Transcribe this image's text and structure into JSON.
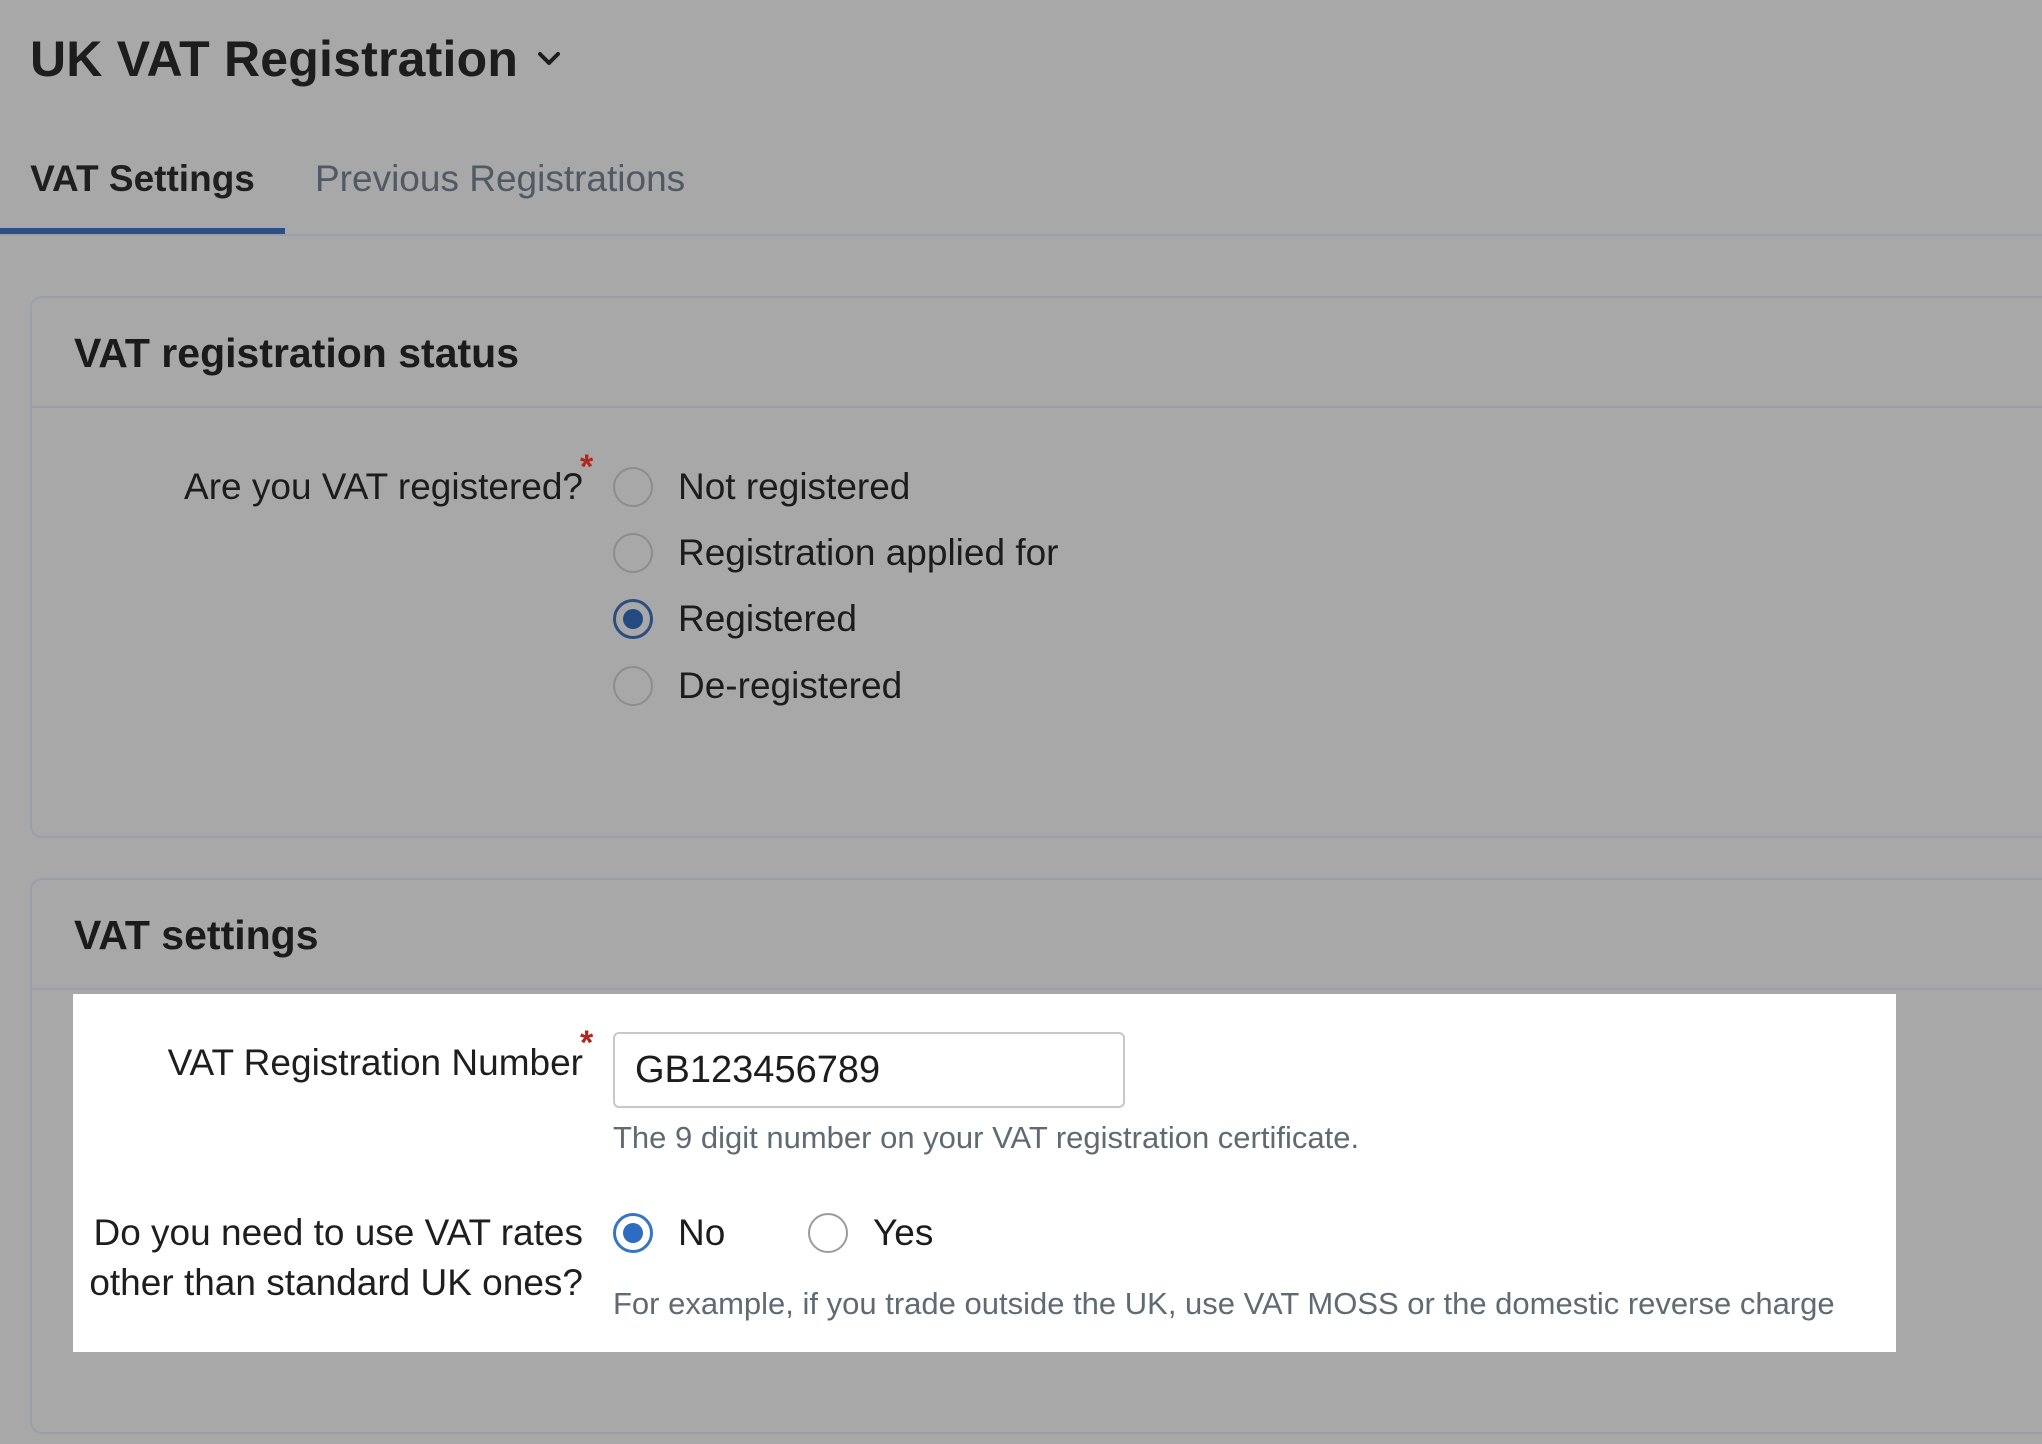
{
  "header": {
    "title": "UK VAT Registration",
    "title_icon": "chevron-down-icon"
  },
  "tabs": [
    {
      "label": "VAT Settings",
      "active": true
    },
    {
      "label": "Previous Registrations",
      "active": false
    }
  ],
  "status_card": {
    "title": "VAT registration status",
    "question": "Are you VAT registered?",
    "required_mark": "*",
    "options": [
      {
        "label": "Not registered",
        "selected": false
      },
      {
        "label": "Registration applied for",
        "selected": false
      },
      {
        "label": "Registered",
        "selected": true
      },
      {
        "label": "De-registered",
        "selected": false
      }
    ]
  },
  "settings_card": {
    "title": "VAT settings",
    "reg_number": {
      "label": "VAT Registration Number",
      "required_mark": "*",
      "value": "GB123456789",
      "help": "The 9 digit number on your VAT registration certificate."
    },
    "other_rates": {
      "label_line1": "Do you need to use VAT rates",
      "label_line2": "other than standard UK ones?",
      "options": [
        {
          "label": "No",
          "selected": true
        },
        {
          "label": "Yes",
          "selected": false
        }
      ],
      "help": "For example, if you trade outside the UK, use VAT MOSS or the domestic reverse charge"
    }
  },
  "colors": {
    "background": "#a8a8a8",
    "tab_underline": "#2c4e86",
    "radio_selected": "#244a82",
    "required": "#b3261e",
    "help_text": "#5f6b73"
  }
}
